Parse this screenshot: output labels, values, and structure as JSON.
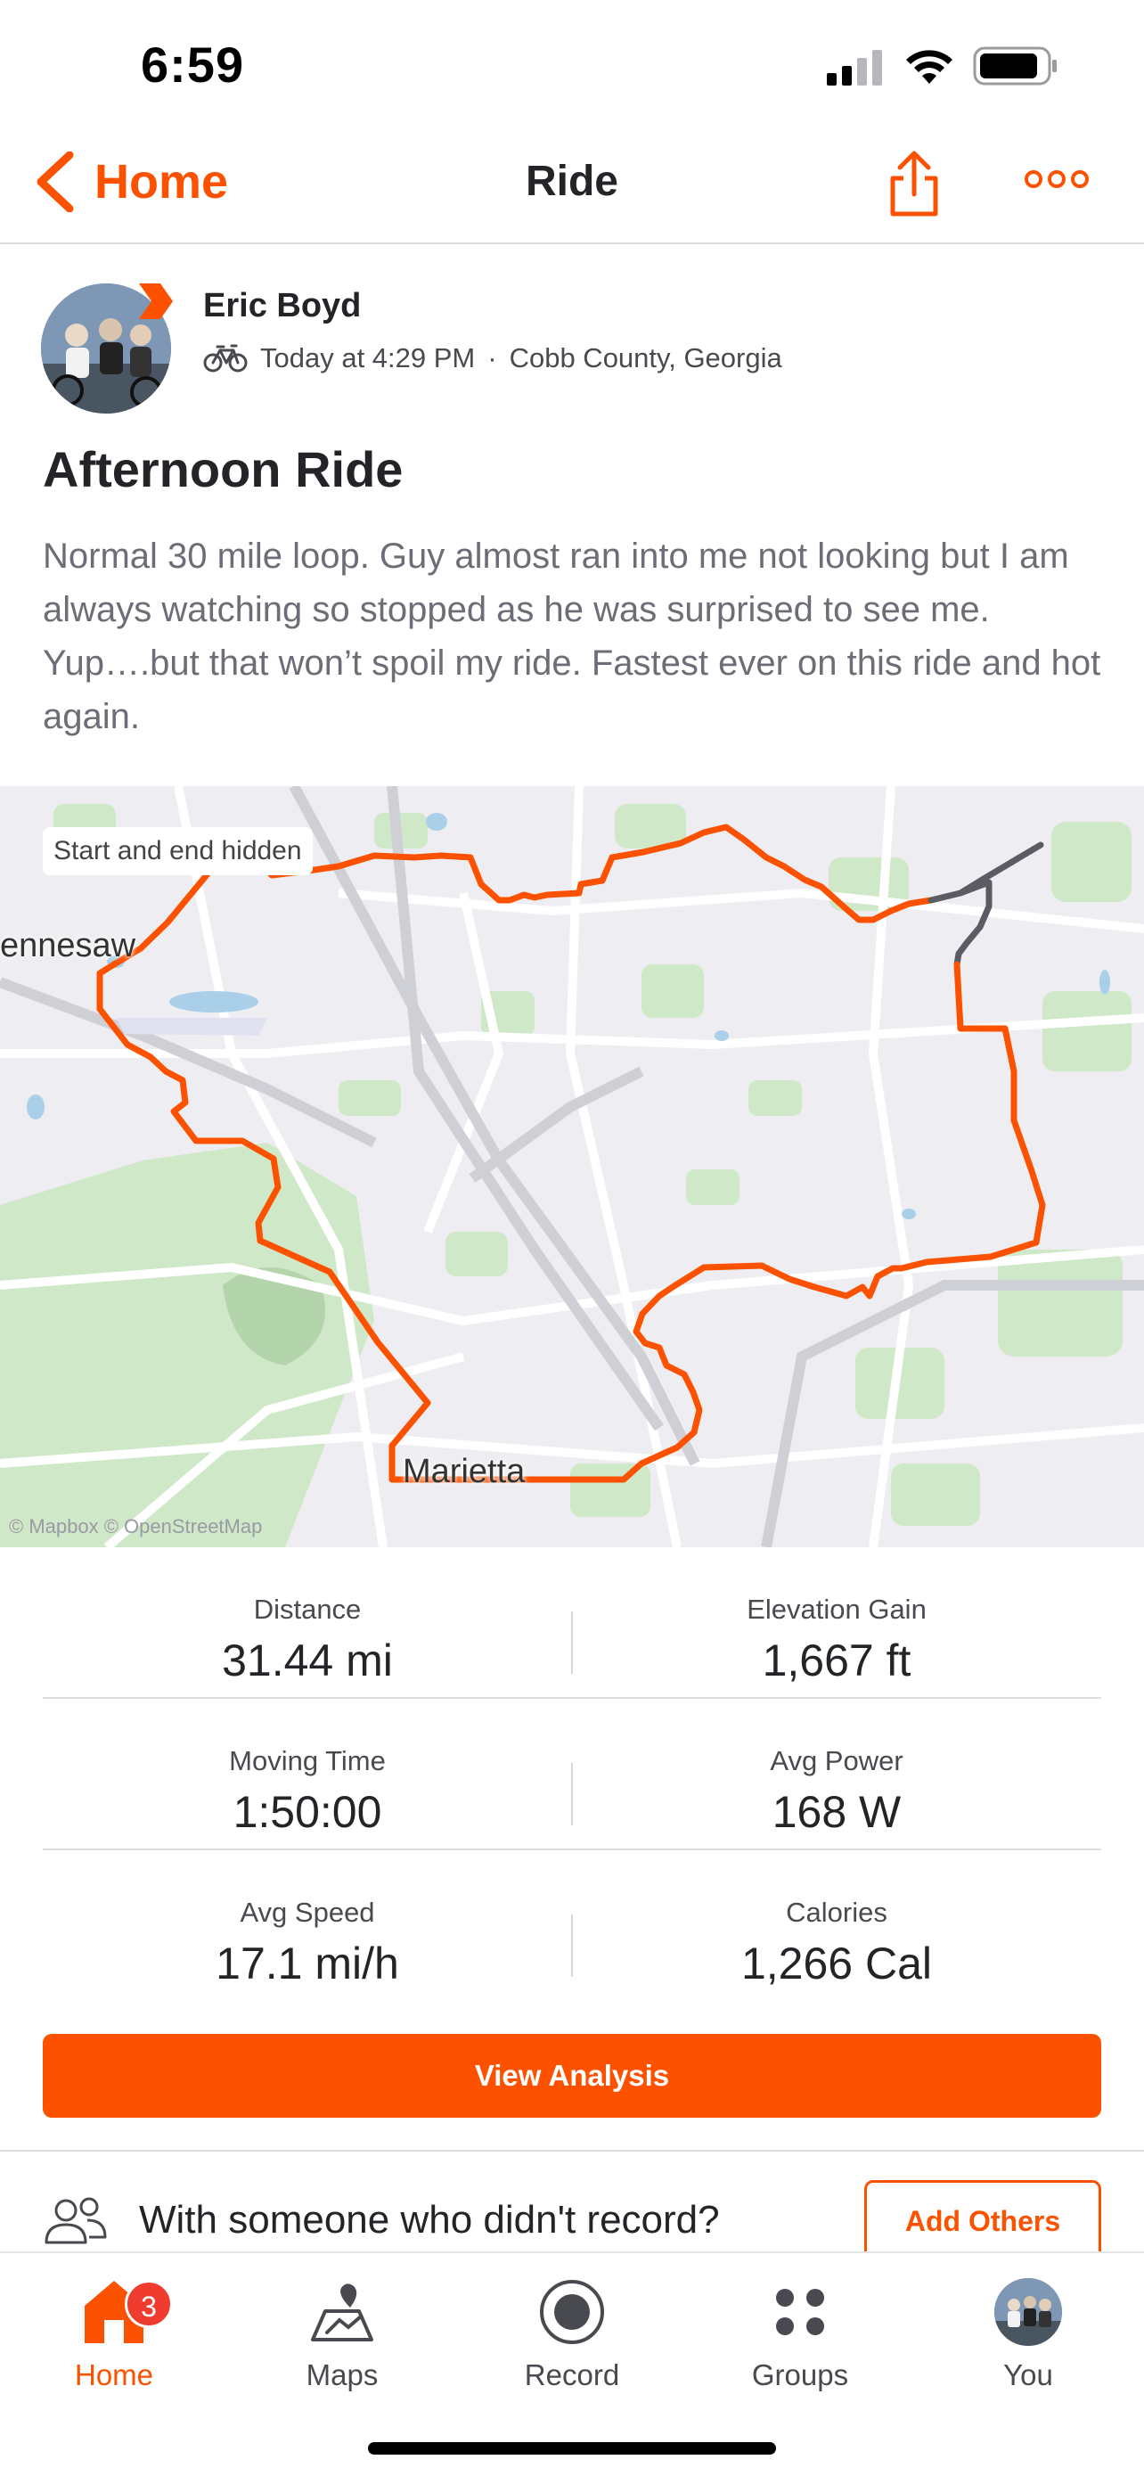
{
  "status_bar": {
    "time": "6:59"
  },
  "nav": {
    "back_label": "Home",
    "title": "Ride"
  },
  "athlete": {
    "name": "Eric Boyd",
    "timestamp": "Today at 4:29 PM",
    "separator": "·",
    "location": "Cobb County, Georgia"
  },
  "activity": {
    "title": "Afternoon Ride",
    "description": "Normal 30 mile loop. Guy almost ran into me not looking but I am always watching so stopped as he was surprised to see me. Yup….but that won’t spoil my ride. Fastest ever on this ride and hot again."
  },
  "map": {
    "chip": "Start and end hidden",
    "label_kennesaw": "ennesaw",
    "label_marietta": "Marietta",
    "attribution": "© Mapbox © OpenStreetMap",
    "route_color": "#fc5200"
  },
  "stats": [
    [
      {
        "label": "Distance",
        "value": "31.44 mi"
      },
      {
        "label": "Elevation Gain",
        "value": "1,667 ft"
      }
    ],
    [
      {
        "label": "Moving Time",
        "value": "1:50:00"
      },
      {
        "label": "Avg Power",
        "value": "168 W"
      }
    ],
    [
      {
        "label": "Avg Speed",
        "value": "17.1 mi/h"
      },
      {
        "label": "Calories",
        "value": "1,266 Cal"
      }
    ]
  ],
  "analysis_button": "View Analysis",
  "others": {
    "text": "With someone who didn't record?",
    "button": "Add Others"
  },
  "tabs": [
    {
      "label": "Home",
      "badge": "3",
      "icon": "home-icon",
      "active": true
    },
    {
      "label": "Maps",
      "icon": "maps-icon"
    },
    {
      "label": "Record",
      "icon": "record-icon"
    },
    {
      "label": "Groups",
      "icon": "groups-icon"
    },
    {
      "label": "You",
      "icon": "avatar"
    }
  ],
  "colors": {
    "accent": "#fc5200",
    "badge": "#f03c2f",
    "text": "#242428"
  }
}
